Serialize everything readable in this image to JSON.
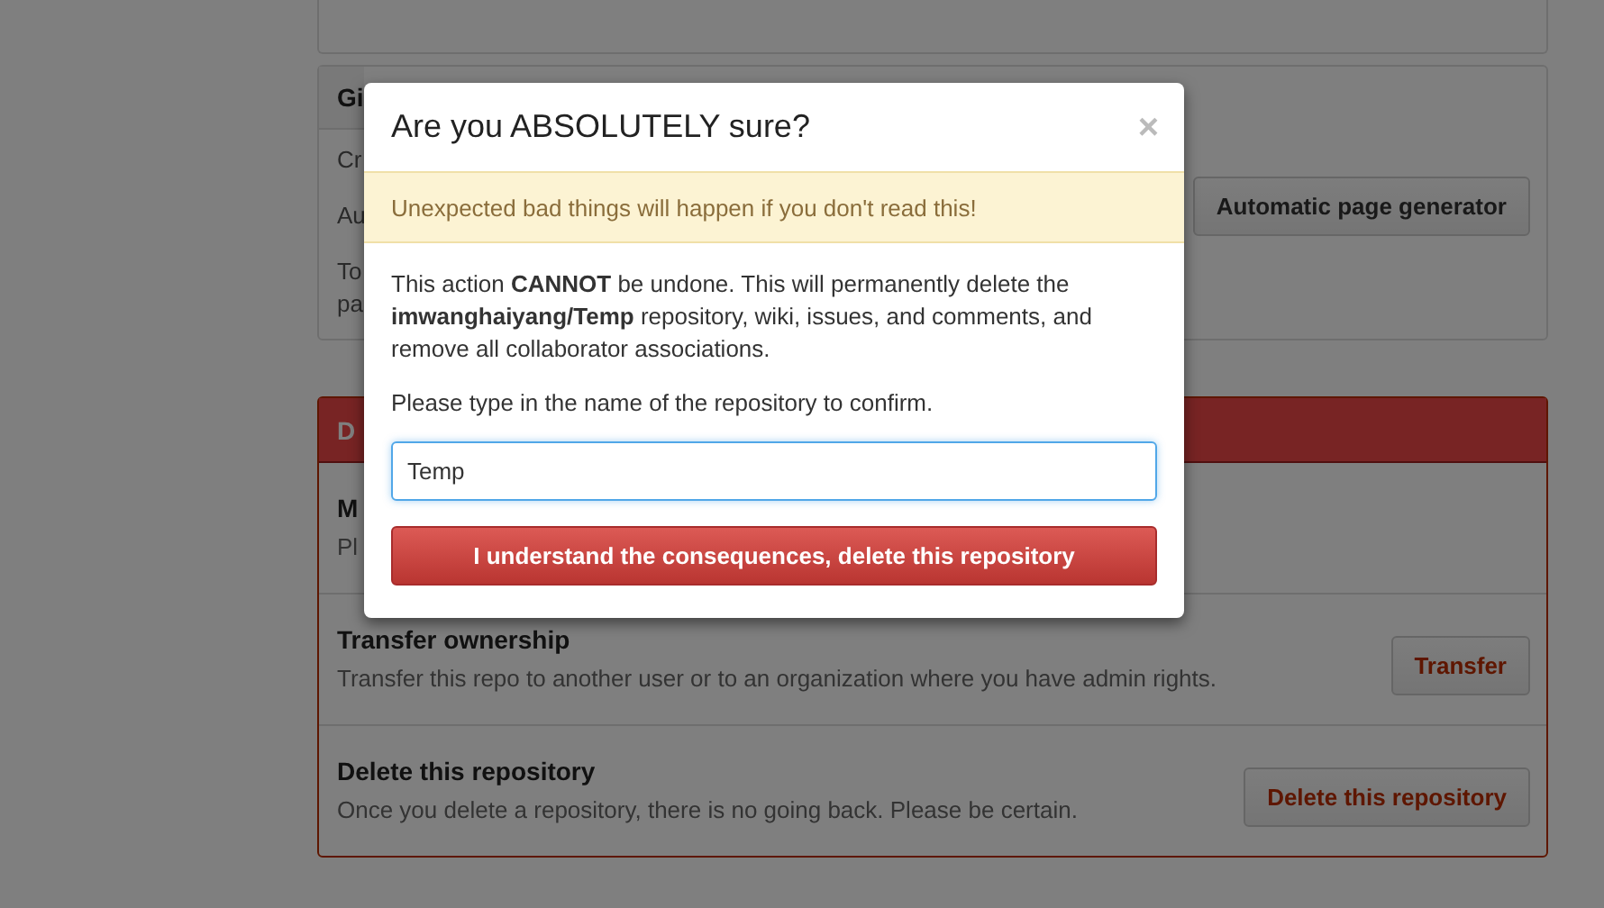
{
  "pages_section": {
    "title": "Gi",
    "paragraphs": [
      "Cr",
      "Au",
      "To\npa"
    ],
    "button": "Automatic page generator"
  },
  "danger_zone": {
    "title": "D",
    "items": [
      {
        "title": "M",
        "description": "Pl"
      },
      {
        "title": "Transfer ownership",
        "description": "Transfer this repo to another user or to an organization where you have admin rights.",
        "button": "Transfer"
      },
      {
        "title": "Delete this repository",
        "description": "Once you delete a repository, there is no going back. Please be certain.",
        "button": "Delete this repository"
      }
    ]
  },
  "dialog": {
    "title": "Are you ABSOLUTELY sure?",
    "close": "×",
    "warning": "Unexpected bad things will happen if you don't read this!",
    "message": "This action **CANNOT** be undone. This will permanently delete the **imwanghaiyang/Temp** repository, wiki, issues, and comments, and remove all collaborator associations.",
    "prompt": "Please type in the name of the repository to confirm.",
    "input": {
      "value": "Temp"
    },
    "confirm_button": "I understand the consequences, delete this repository"
  }
}
